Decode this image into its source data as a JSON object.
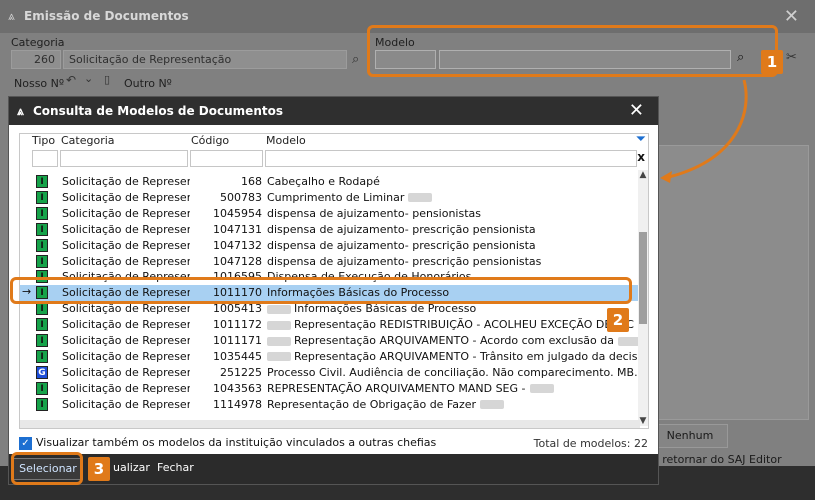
{
  "background_window": {
    "title": "Emissão de Documentos",
    "categoria_label": "Categoria",
    "categoria_code": "260",
    "categoria_value": "Solicitação de Representação",
    "modelo_label": "Modelo",
    "nosso_no_label": "Nosso Nº",
    "outro_no_label": "Outro Nº",
    "nenhum_button": "Nenhum",
    "editor_text": "o retornar do SAJ Editor"
  },
  "dialog": {
    "title": "Consulta de Modelos de Documentos",
    "columns": [
      "Tipo",
      "Categoria",
      "Código",
      "Modelo"
    ],
    "rows": [
      {
        "tipo": "I",
        "categoria": "Solicitação de Representa",
        "codigo": "168",
        "modelo": "Cabeçalho e Rodapé",
        "redact_before": false,
        "redact_after": false
      },
      {
        "tipo": "I",
        "categoria": "Solicitação de Representa",
        "codigo": "500783",
        "modelo": "Cumprimento de Liminar",
        "redact_before": false,
        "redact_after": true
      },
      {
        "tipo": "I",
        "categoria": "Solicitação de Representa",
        "codigo": "1045954",
        "modelo": "dispensa de ajuizamento- pensionistas",
        "redact_before": false,
        "redact_after": false
      },
      {
        "tipo": "I",
        "categoria": "Solicitação de Representa",
        "codigo": "1047131",
        "modelo": "dispensa de ajuizamento- prescrição pensionista",
        "redact_before": false,
        "redact_after": false
      },
      {
        "tipo": "I",
        "categoria": "Solicitação de Representa",
        "codigo": "1047132",
        "modelo": "dispensa de ajuizamento- prescrição pensionista",
        "redact_before": false,
        "redact_after": false
      },
      {
        "tipo": "I",
        "categoria": "Solicitação de Representa",
        "codigo": "1047128",
        "modelo": "dispensa de ajuizamento- prescrição pensionistas",
        "redact_before": false,
        "redact_after": false
      },
      {
        "tipo": "I",
        "categoria": "Solicitação de Representa",
        "codigo": "1016595",
        "modelo": "Dispensa de Execução de Honorários",
        "redact_before": false,
        "redact_after": false
      },
      {
        "tipo": "I",
        "categoria": "Solicitação de Representa",
        "codigo": "1011170",
        "modelo": "Informações Básicas do Processo",
        "redact_before": false,
        "redact_after": false,
        "selected": true
      },
      {
        "tipo": "I",
        "categoria": "Solicitação de Representa",
        "codigo": "1005413",
        "modelo": "Informações Básicas de Processo",
        "redact_before": true,
        "redact_after": false
      },
      {
        "tipo": "I",
        "categoria": "Solicitação de Representa",
        "codigo": "1011172",
        "modelo": "Representação REDISTRIBUIÇÃO - ACOLHEU EXCEÇÃO DE INC",
        "redact_before": true,
        "redact_after": false
      },
      {
        "tipo": "I",
        "categoria": "Solicitação de Representa",
        "codigo": "1011171",
        "modelo": "Representação ARQUIVAMENTO - Acordo com exclusão da",
        "redact_before": true,
        "redact_after": true
      },
      {
        "tipo": "I",
        "categoria": "Solicitação de Representa",
        "codigo": "1035445",
        "modelo": "Representação ARQUIVAMENTO - Trânsito em julgado da decisão fa",
        "redact_before": true,
        "redact_after": false
      },
      {
        "tipo": "G",
        "categoria": "Solicitação de Representa",
        "codigo": "251225",
        "modelo": "Processo Civil. Audiência de conciliação. Não comparecimento. MB.",
        "redact_before": false,
        "redact_after": false
      },
      {
        "tipo": "I",
        "categoria": "Solicitação de Representa",
        "codigo": "1043563",
        "modelo": "REPRESENTAÇÃO ARQUIVAMENTO MAND SEG -",
        "redact_before": false,
        "redact_after": true
      },
      {
        "tipo": "I",
        "categoria": "Solicitação de Representa",
        "codigo": "1114978",
        "modelo": "Representação de Obrigação de Fazer",
        "redact_before": false,
        "redact_after": true
      }
    ],
    "checkbox_label": "Visualizar também os modelos da instituição vinculados a outras chefias",
    "total_label": "Total de modelos: 22",
    "buttons": {
      "select": "Selecionar",
      "view": "ualizar",
      "close": "Fechar"
    }
  },
  "callouts": [
    "1",
    "2",
    "3"
  ],
  "colors": {
    "highlight": "#e07a1a",
    "selection": "#a8d0f2",
    "type_i": "#16a34a",
    "type_g": "#1d4ed8"
  }
}
